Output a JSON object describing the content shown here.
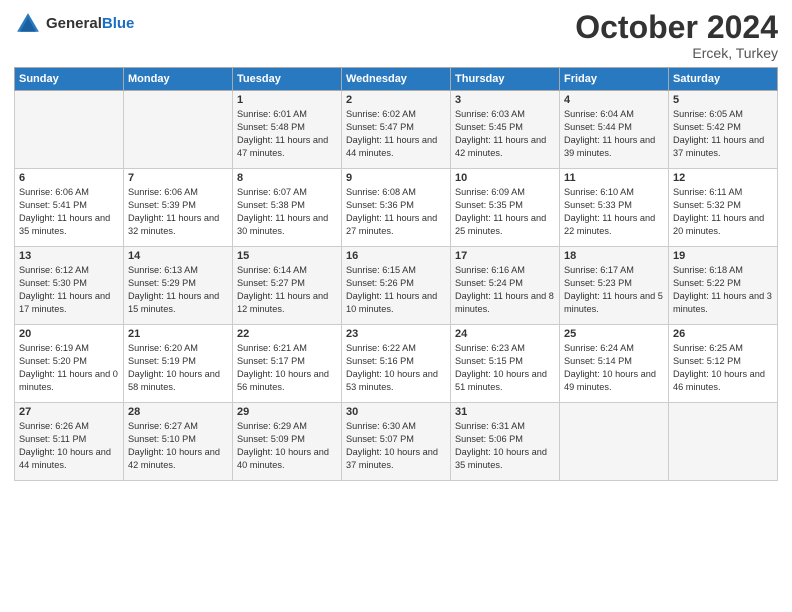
{
  "header": {
    "logo_general": "General",
    "logo_blue": "Blue",
    "month_title": "October 2024",
    "location": "Ercek, Turkey"
  },
  "calendar": {
    "days_of_week": [
      "Sunday",
      "Monday",
      "Tuesday",
      "Wednesday",
      "Thursday",
      "Friday",
      "Saturday"
    ],
    "weeks": [
      [
        {
          "day": "",
          "content": ""
        },
        {
          "day": "",
          "content": ""
        },
        {
          "day": "1",
          "sunrise": "Sunrise: 6:01 AM",
          "sunset": "Sunset: 5:48 PM",
          "daylight": "Daylight: 11 hours and 47 minutes."
        },
        {
          "day": "2",
          "sunrise": "Sunrise: 6:02 AM",
          "sunset": "Sunset: 5:47 PM",
          "daylight": "Daylight: 11 hours and 44 minutes."
        },
        {
          "day": "3",
          "sunrise": "Sunrise: 6:03 AM",
          "sunset": "Sunset: 5:45 PM",
          "daylight": "Daylight: 11 hours and 42 minutes."
        },
        {
          "day": "4",
          "sunrise": "Sunrise: 6:04 AM",
          "sunset": "Sunset: 5:44 PM",
          "daylight": "Daylight: 11 hours and 39 minutes."
        },
        {
          "day": "5",
          "sunrise": "Sunrise: 6:05 AM",
          "sunset": "Sunset: 5:42 PM",
          "daylight": "Daylight: 11 hours and 37 minutes."
        }
      ],
      [
        {
          "day": "6",
          "sunrise": "Sunrise: 6:06 AM",
          "sunset": "Sunset: 5:41 PM",
          "daylight": "Daylight: 11 hours and 35 minutes."
        },
        {
          "day": "7",
          "sunrise": "Sunrise: 6:06 AM",
          "sunset": "Sunset: 5:39 PM",
          "daylight": "Daylight: 11 hours and 32 minutes."
        },
        {
          "day": "8",
          "sunrise": "Sunrise: 6:07 AM",
          "sunset": "Sunset: 5:38 PM",
          "daylight": "Daylight: 11 hours and 30 minutes."
        },
        {
          "day": "9",
          "sunrise": "Sunrise: 6:08 AM",
          "sunset": "Sunset: 5:36 PM",
          "daylight": "Daylight: 11 hours and 27 minutes."
        },
        {
          "day": "10",
          "sunrise": "Sunrise: 6:09 AM",
          "sunset": "Sunset: 5:35 PM",
          "daylight": "Daylight: 11 hours and 25 minutes."
        },
        {
          "day": "11",
          "sunrise": "Sunrise: 6:10 AM",
          "sunset": "Sunset: 5:33 PM",
          "daylight": "Daylight: 11 hours and 22 minutes."
        },
        {
          "day": "12",
          "sunrise": "Sunrise: 6:11 AM",
          "sunset": "Sunset: 5:32 PM",
          "daylight": "Daylight: 11 hours and 20 minutes."
        }
      ],
      [
        {
          "day": "13",
          "sunrise": "Sunrise: 6:12 AM",
          "sunset": "Sunset: 5:30 PM",
          "daylight": "Daylight: 11 hours and 17 minutes."
        },
        {
          "day": "14",
          "sunrise": "Sunrise: 6:13 AM",
          "sunset": "Sunset: 5:29 PM",
          "daylight": "Daylight: 11 hours and 15 minutes."
        },
        {
          "day": "15",
          "sunrise": "Sunrise: 6:14 AM",
          "sunset": "Sunset: 5:27 PM",
          "daylight": "Daylight: 11 hours and 12 minutes."
        },
        {
          "day": "16",
          "sunrise": "Sunrise: 6:15 AM",
          "sunset": "Sunset: 5:26 PM",
          "daylight": "Daylight: 11 hours and 10 minutes."
        },
        {
          "day": "17",
          "sunrise": "Sunrise: 6:16 AM",
          "sunset": "Sunset: 5:24 PM",
          "daylight": "Daylight: 11 hours and 8 minutes."
        },
        {
          "day": "18",
          "sunrise": "Sunrise: 6:17 AM",
          "sunset": "Sunset: 5:23 PM",
          "daylight": "Daylight: 11 hours and 5 minutes."
        },
        {
          "day": "19",
          "sunrise": "Sunrise: 6:18 AM",
          "sunset": "Sunset: 5:22 PM",
          "daylight": "Daylight: 11 hours and 3 minutes."
        }
      ],
      [
        {
          "day": "20",
          "sunrise": "Sunrise: 6:19 AM",
          "sunset": "Sunset: 5:20 PM",
          "daylight": "Daylight: 11 hours and 0 minutes."
        },
        {
          "day": "21",
          "sunrise": "Sunrise: 6:20 AM",
          "sunset": "Sunset: 5:19 PM",
          "daylight": "Daylight: 10 hours and 58 minutes."
        },
        {
          "day": "22",
          "sunrise": "Sunrise: 6:21 AM",
          "sunset": "Sunset: 5:17 PM",
          "daylight": "Daylight: 10 hours and 56 minutes."
        },
        {
          "day": "23",
          "sunrise": "Sunrise: 6:22 AM",
          "sunset": "Sunset: 5:16 PM",
          "daylight": "Daylight: 10 hours and 53 minutes."
        },
        {
          "day": "24",
          "sunrise": "Sunrise: 6:23 AM",
          "sunset": "Sunset: 5:15 PM",
          "daylight": "Daylight: 10 hours and 51 minutes."
        },
        {
          "day": "25",
          "sunrise": "Sunrise: 6:24 AM",
          "sunset": "Sunset: 5:14 PM",
          "daylight": "Daylight: 10 hours and 49 minutes."
        },
        {
          "day": "26",
          "sunrise": "Sunrise: 6:25 AM",
          "sunset": "Sunset: 5:12 PM",
          "daylight": "Daylight: 10 hours and 46 minutes."
        }
      ],
      [
        {
          "day": "27",
          "sunrise": "Sunrise: 6:26 AM",
          "sunset": "Sunset: 5:11 PM",
          "daylight": "Daylight: 10 hours and 44 minutes."
        },
        {
          "day": "28",
          "sunrise": "Sunrise: 6:27 AM",
          "sunset": "Sunset: 5:10 PM",
          "daylight": "Daylight: 10 hours and 42 minutes."
        },
        {
          "day": "29",
          "sunrise": "Sunrise: 6:29 AM",
          "sunset": "Sunset: 5:09 PM",
          "daylight": "Daylight: 10 hours and 40 minutes."
        },
        {
          "day": "30",
          "sunrise": "Sunrise: 6:30 AM",
          "sunset": "Sunset: 5:07 PM",
          "daylight": "Daylight: 10 hours and 37 minutes."
        },
        {
          "day": "31",
          "sunrise": "Sunrise: 6:31 AM",
          "sunset": "Sunset: 5:06 PM",
          "daylight": "Daylight: 10 hours and 35 minutes."
        },
        {
          "day": "",
          "content": ""
        },
        {
          "day": "",
          "content": ""
        }
      ]
    ]
  }
}
